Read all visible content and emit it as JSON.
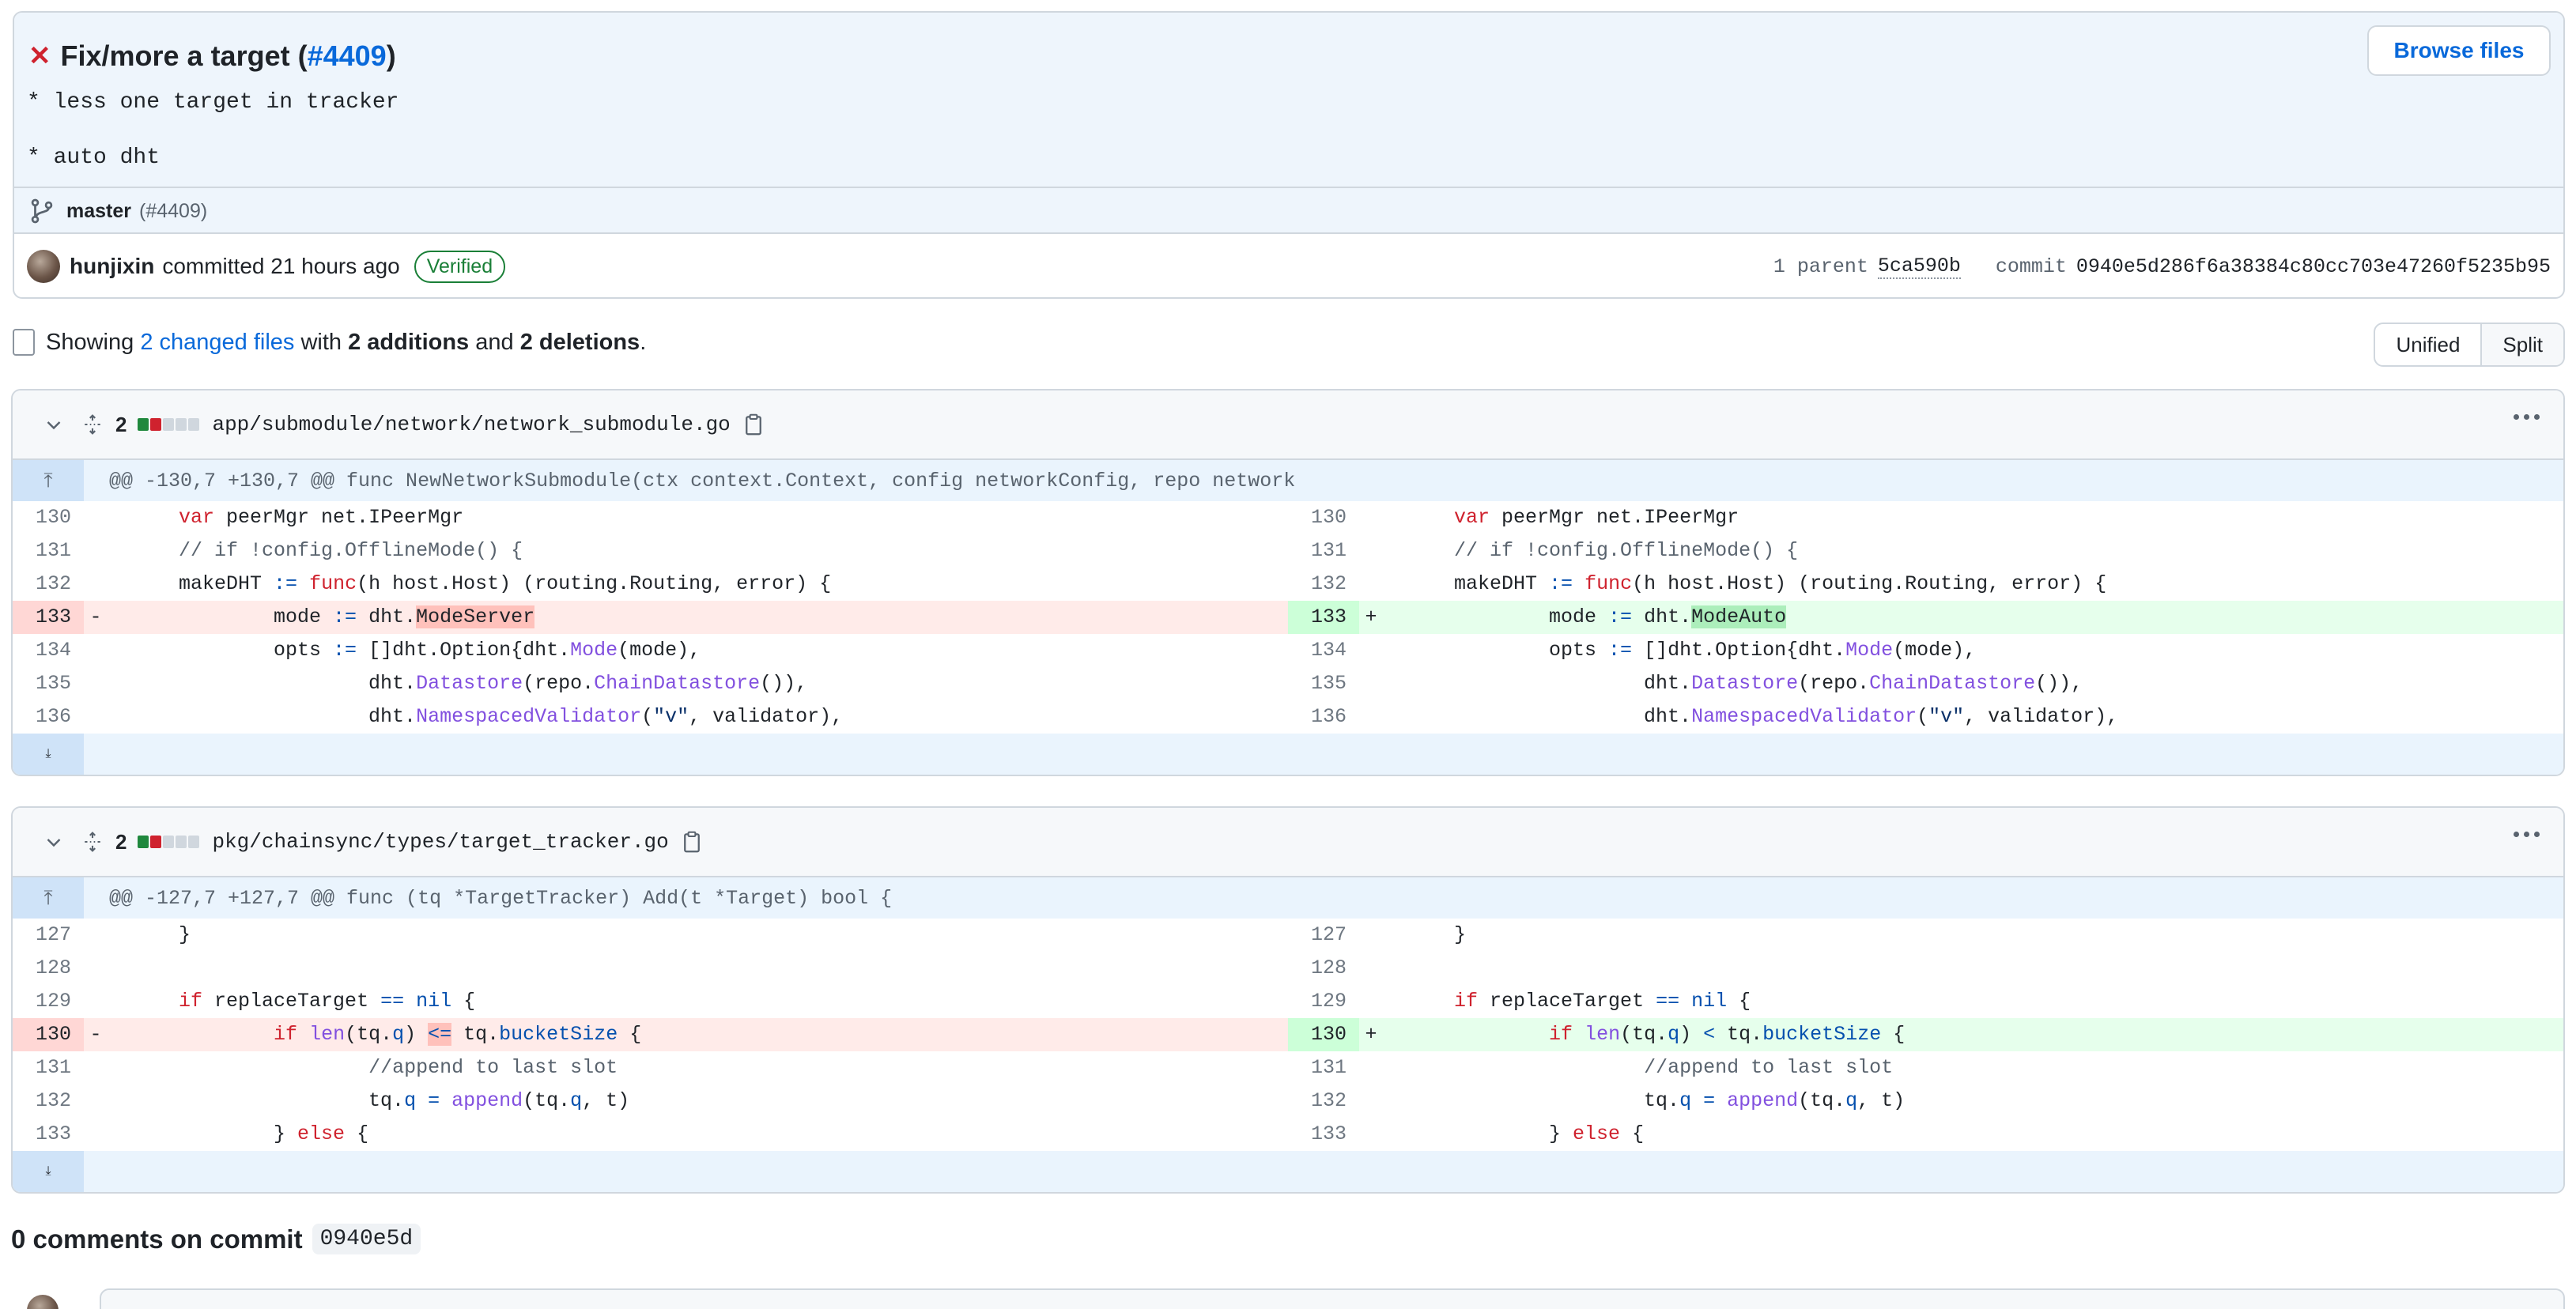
{
  "commit": {
    "status_icon": "x-icon",
    "title_prefix": "Fix/more a target (",
    "issue_ref": "#4409",
    "title_suffix": ")",
    "body_line1": "* less one target in tracker",
    "body_line2": "* auto dht",
    "branch": "master",
    "branch_pr": "(#4409)",
    "browse_label": "Browse files",
    "author": "hunjixin",
    "committed_text": "committed 21 hours ago",
    "verified_label": "Verified",
    "parent_label": "1 parent",
    "parent_sha": "5ca590b",
    "commit_label": "commit",
    "commit_sha": "0940e5d286f6a38384c80cc703e47260f5235b95"
  },
  "summary": {
    "showing": "Showing",
    "changed_files": "2 changed files",
    "with": "with",
    "additions": "2 additions",
    "and": "and",
    "deletions": "2 deletions",
    "period": "."
  },
  "view_toggle": {
    "unified": "Unified",
    "split": "Split"
  },
  "colors": {
    "addition": "#1f883d",
    "deletion": "#cf222e",
    "link": "#0969da"
  },
  "files": [
    {
      "count": "2",
      "path": "app/submodule/network/network_submodule.go",
      "hunk": "@@ -130,7 +130,7 @@ func NewNetworkSubmodule(ctx context.Context, config networkConfig, repo network"
    },
    {
      "count": "2",
      "path": "pkg/chainsync/types/target_tracker.go",
      "hunk": "@@ -127,7 +127,7 @@ func (tq *TargetTracker) Add(t *Target) bool {"
    }
  ],
  "comments": {
    "title": "0 comments on commit",
    "sha": "0940e5d"
  }
}
